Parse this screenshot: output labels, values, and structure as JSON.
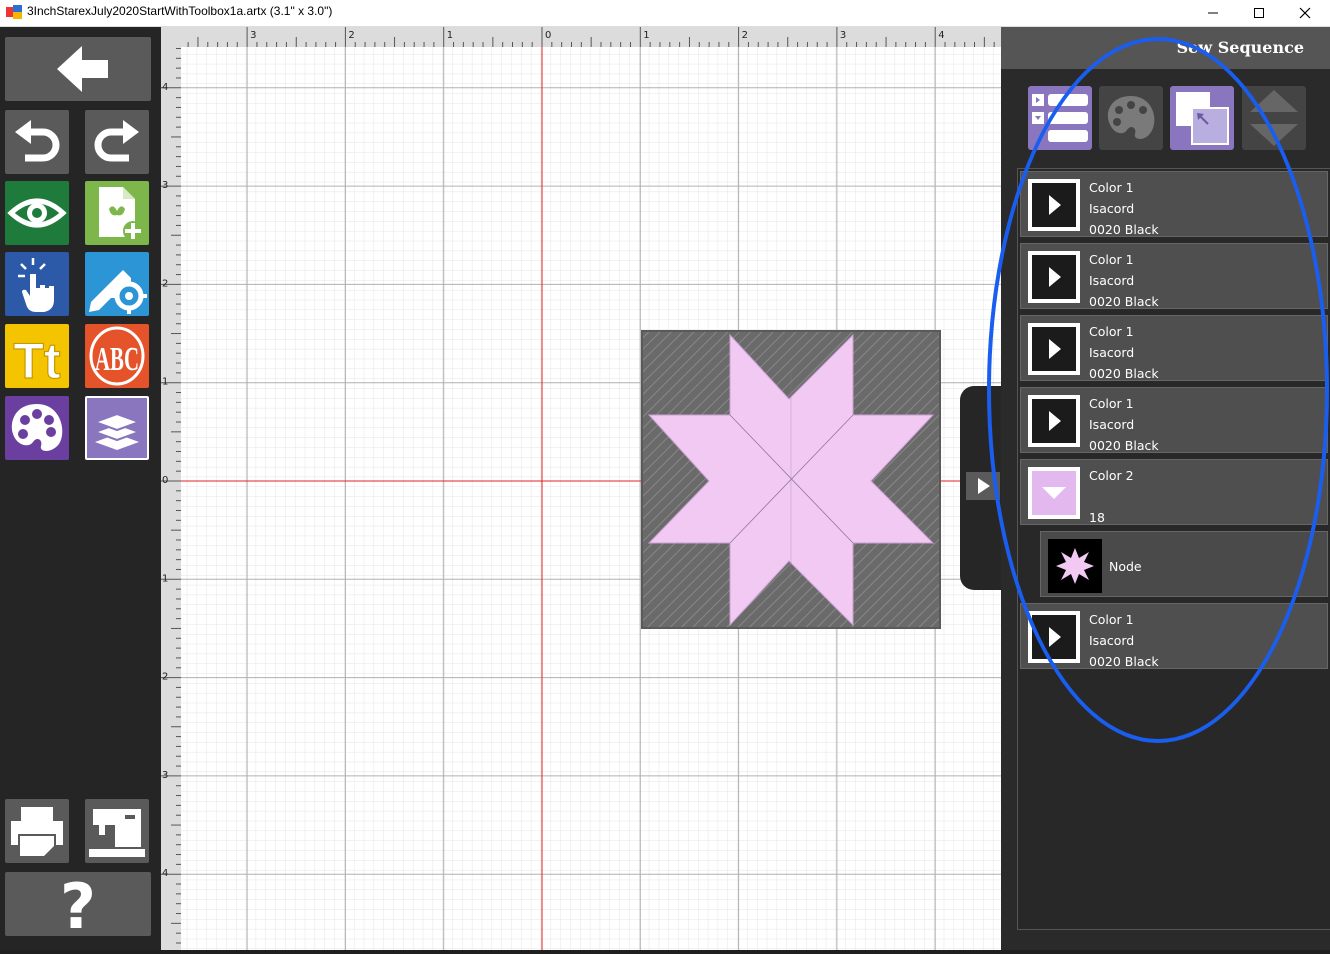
{
  "window": {
    "title": "3InchStarexJuly2020StartWithToolbox1a.artx (3.1\" x 3.0\")"
  },
  "toolbar": {
    "back": "back-arrow-icon",
    "undo": "undo-icon",
    "redo": "redo-icon",
    "view": "eye-icon",
    "add_design": "add-design-icon",
    "select": "touch-select-icon",
    "edit": "edit-gear-icon",
    "text": "Tt",
    "monogram": "ABC",
    "colors": "palette-icon",
    "layers": "layers-icon",
    "print": "printer-icon",
    "sew": "sewing-machine-icon",
    "help": "?"
  },
  "ruler": {
    "top_labels": [
      "3",
      "2",
      "1",
      "0",
      "1",
      "2",
      "3",
      "4"
    ],
    "left_labels": [
      "4",
      "3",
      "2",
      "1",
      "0",
      "1",
      "2",
      "3",
      "4"
    ]
  },
  "panel": {
    "title": "Sew Sequence",
    "tools": [
      "sequence-list-icon",
      "palette-icon",
      "overlap-icon",
      "move-up-down-icon"
    ],
    "items": [
      {
        "kind": "color",
        "label": "Color 1",
        "brand": "Isacord",
        "thread": "0020 Black",
        "swatch": "#1b1b1b"
      },
      {
        "kind": "color",
        "label": "Color 1",
        "brand": "Isacord",
        "thread": "0020 Black",
        "swatch": "#1b1b1b"
      },
      {
        "kind": "color",
        "label": "Color 1",
        "brand": "Isacord",
        "thread": "0020 Black",
        "swatch": "#1b1b1b"
      },
      {
        "kind": "color",
        "label": "Color 1",
        "brand": "Isacord",
        "thread": "0020 Black",
        "swatch": "#1b1b1b"
      },
      {
        "kind": "color",
        "label": "Color 2",
        "brand": "",
        "thread": "18",
        "swatch": "#e3b8ef"
      },
      {
        "kind": "node",
        "label": "Node"
      },
      {
        "kind": "color",
        "label": "Color 1",
        "brand": "Isacord",
        "thread": "0020 Black",
        "swatch": "#1b1b1b"
      }
    ]
  },
  "colors": {
    "accent": "#1a5ef0",
    "star": "#f1c9f3",
    "block": "#6e6e6e"
  }
}
